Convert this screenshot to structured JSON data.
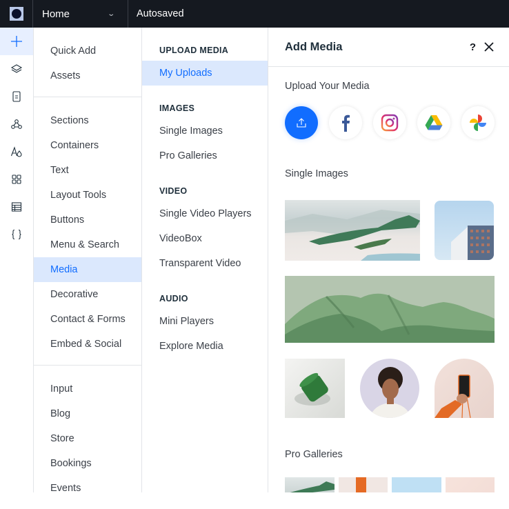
{
  "topbar": {
    "logo_icon": "wix-logo-icon",
    "page_label": "Home",
    "page_chevron": "chevron-down-icon",
    "status": "Autosaved"
  },
  "rail": {
    "items": [
      {
        "icon": "plus-icon",
        "active": true
      },
      {
        "icon": "layers-icon"
      },
      {
        "icon": "page-icon"
      },
      {
        "icon": "apps-graph-icon"
      },
      {
        "icon": "theme-icon"
      },
      {
        "icon": "app-market-icon"
      },
      {
        "icon": "table-icon"
      },
      {
        "icon": "code-braces-icon"
      }
    ]
  },
  "categories": {
    "groups": [
      [
        "Quick Add",
        "Assets"
      ],
      [
        "Sections",
        "Containers",
        "Text",
        "Layout Tools",
        "Buttons",
        "Menu & Search",
        "Media",
        "Decorative",
        "Contact & Forms",
        "Embed & Social"
      ],
      [
        "Input",
        "Blog",
        "Store",
        "Bookings",
        "Events"
      ]
    ],
    "active": "Media"
  },
  "submenu": {
    "sections": [
      {
        "title": "UPLOAD MEDIA",
        "items": [
          "My Uploads"
        ]
      },
      {
        "title": "IMAGES",
        "items": [
          "Single Images",
          "Pro Galleries"
        ]
      },
      {
        "title": "VIDEO",
        "items": [
          "Single Video Players",
          "VideoBox",
          "Transparent Video"
        ]
      },
      {
        "title": "AUDIO",
        "items": [
          "Mini Players",
          "Explore Media"
        ]
      }
    ],
    "active": "My Uploads"
  },
  "panel": {
    "title": "Add Media",
    "help_label": "?",
    "close_icon": "close-icon",
    "upload_label": "Upload Your Media",
    "sources": [
      "upload-icon",
      "facebook-icon",
      "instagram-icon",
      "google-drive-icon",
      "google-photos-icon"
    ],
    "single_images_label": "Single Images",
    "single_images": [
      "snowy-mountains-image",
      "office-building-image",
      "green-fabric-image",
      "green-jar-image",
      "woman-portrait-image",
      "phone-in-hand-image"
    ],
    "pro_galleries_label": "Pro Galleries",
    "pro_galleries": [
      "gallery-mountains-image",
      "gallery-orange-image",
      "gallery-sky-image",
      "gallery-pink-image"
    ]
  },
  "colors": {
    "accent": "#116dff",
    "active_bg": "#dbe8fd",
    "topbar_bg": "#151920"
  }
}
